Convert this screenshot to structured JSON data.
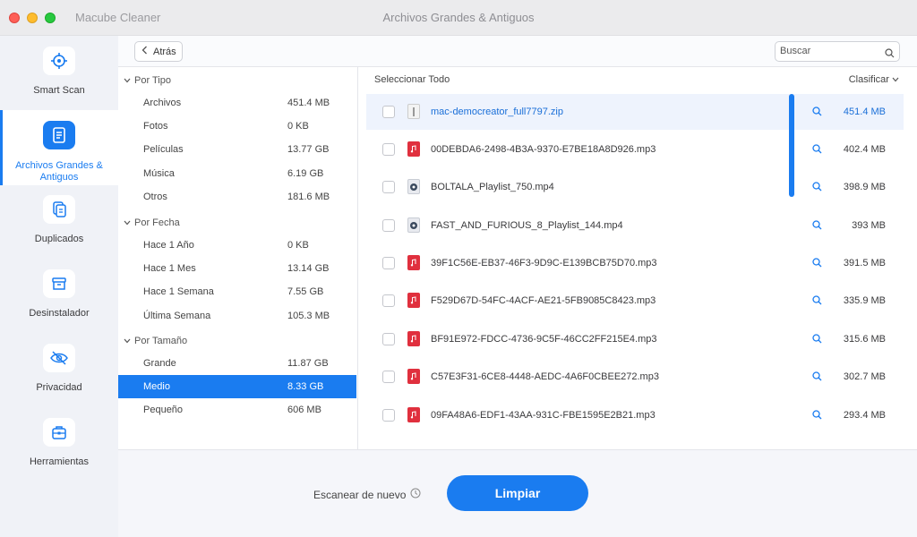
{
  "window": {
    "app_name": "Macube Cleaner",
    "title": "Archivos Grandes & Antiguos"
  },
  "sidebar": {
    "items": [
      {
        "label": "Smart Scan",
        "icon": "crosshair-icon"
      },
      {
        "label": "Archivos Grandes & Antiguos",
        "icon": "document-icon"
      },
      {
        "label": "Duplicados",
        "icon": "copy-icon"
      },
      {
        "label": "Desinstalador",
        "icon": "box-icon"
      },
      {
        "label": "Privacidad",
        "icon": "eye-off-icon"
      },
      {
        "label": "Herramientas",
        "icon": "toolbox-icon"
      }
    ]
  },
  "toolbar": {
    "back_label": "Atrás",
    "search_placeholder": "Buscar"
  },
  "categories": {
    "by_type": {
      "title": "Por Tipo",
      "items": [
        {
          "name": "Archivos",
          "size": "451.4 MB"
        },
        {
          "name": "Fotos",
          "size": "0 KB"
        },
        {
          "name": "Películas",
          "size": "13.77 GB"
        },
        {
          "name": "Música",
          "size": "6.19 GB"
        },
        {
          "name": "Otros",
          "size": "181.6 MB"
        }
      ]
    },
    "by_date": {
      "title": "Por Fecha",
      "items": [
        {
          "name": "Hace 1 Año",
          "size": "0 KB"
        },
        {
          "name": "Hace 1 Mes",
          "size": "13.14 GB"
        },
        {
          "name": "Hace 1 Semana",
          "size": "7.55 GB"
        },
        {
          "name": "Última Semana",
          "size": "105.3 MB"
        }
      ]
    },
    "by_size": {
      "title": "Por Tamaño",
      "items": [
        {
          "name": "Grande",
          "size": "11.87 GB"
        },
        {
          "name": "Medio",
          "size": "8.33 GB",
          "selected": true
        },
        {
          "name": "Pequeño",
          "size": "606 MB"
        }
      ]
    }
  },
  "file_list": {
    "select_all_label": "Seleccionar Todo",
    "sort_label": "Clasificar",
    "files": [
      {
        "name": "mac-democreator_full7797.zip",
        "size": "451.4 MB",
        "type": "zip"
      },
      {
        "name": "00DEBDA6-2498-4B3A-9370-E7BE18A8D926.mp3",
        "size": "402.4 MB",
        "type": "mp3"
      },
      {
        "name": "BOLTALA_Playlist_750.mp4",
        "size": "398.9 MB",
        "type": "mp4"
      },
      {
        "name": "FAST_AND_FURIOUS_8_Playlist_144.mp4",
        "size": "393 MB",
        "type": "mp4"
      },
      {
        "name": "39F1C56E-EB37-46F3-9D9C-E139BCB75D70.mp3",
        "size": "391.5 MB",
        "type": "mp3"
      },
      {
        "name": "F529D67D-54FC-4ACF-AE21-5FB9085C8423.mp3",
        "size": "335.9 MB",
        "type": "mp3"
      },
      {
        "name": "BF91E972-FDCC-4736-9C5F-46CC2FF215E4.mp3",
        "size": "315.6 MB",
        "type": "mp3"
      },
      {
        "name": "C57E3F31-6CE8-4448-AEDC-4A6F0CBEE272.mp3",
        "size": "302.7 MB",
        "type": "mp3"
      },
      {
        "name": "09FA48A6-EDF1-43AA-931C-FBE1595E2B21.mp3",
        "size": "293.4 MB",
        "type": "mp3"
      }
    ]
  },
  "footer": {
    "rescan_label": "Escanear de nuevo",
    "clean_label": "Limpiar"
  },
  "colors": {
    "accent": "#1a7cf0",
    "mp3_icon": "#e0303e"
  }
}
